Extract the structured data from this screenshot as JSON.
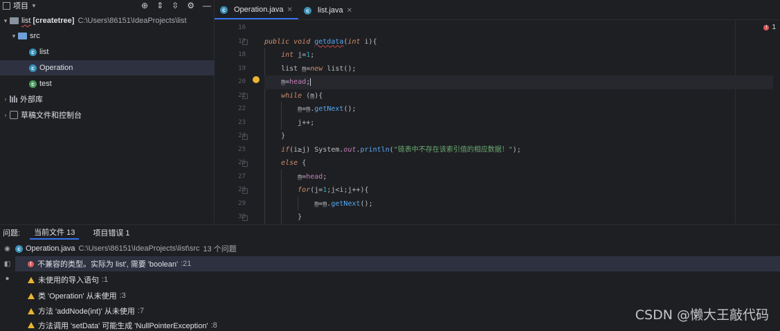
{
  "project_panel": {
    "title": "项目",
    "tree": [
      {
        "label": "list",
        "extra": "[createtree]",
        "path": "C:\\Users\\86151\\IdeaProjects\\list"
      },
      {
        "label": "src"
      },
      {
        "label": "list"
      },
      {
        "label": "Operation"
      },
      {
        "label": "test"
      },
      {
        "label": "外部库"
      },
      {
        "label": "草稿文件和控制台"
      }
    ]
  },
  "editor": {
    "tabs": [
      {
        "label": "Operation.java"
      },
      {
        "label": "list.java"
      }
    ],
    "error_count": "1",
    "line_numbers": [
      "16",
      "17",
      "18",
      "19",
      "20",
      "21",
      "22",
      "23",
      "24",
      "25",
      "26",
      "27",
      "28",
      "29",
      "30"
    ]
  },
  "problems": {
    "label": "问题:",
    "tabs": [
      {
        "label": "当前文件 13"
      },
      {
        "label": "项目错误 1"
      }
    ],
    "file": {
      "name": "Operation.java",
      "path": "C:\\Users\\86151\\IdeaProjects\\list\\src",
      "count": "13 个问题"
    },
    "items": [
      {
        "text": "不兼容的类型。实际为 list', 需要 'boolean'",
        "line": ":21",
        "level": "error"
      },
      {
        "text": "未使用的导入语句",
        "line": ":1",
        "level": "warning"
      },
      {
        "text": "类 'Operation' 从未使用",
        "line": ":3",
        "level": "warning"
      },
      {
        "text": "方法 'addNode(int)' 从未使用",
        "line": ":7",
        "level": "warning"
      },
      {
        "text": "方法调用 'setData' 可能生成 'NullPointerException'",
        "line": ":8",
        "level": "warning"
      }
    ]
  },
  "watermark": "CSDN @懒大王敲代码",
  "colors": {
    "accent": "#3574f0",
    "error": "#db5c5c",
    "warning": "#e8b431",
    "selection": "#2e3140"
  }
}
